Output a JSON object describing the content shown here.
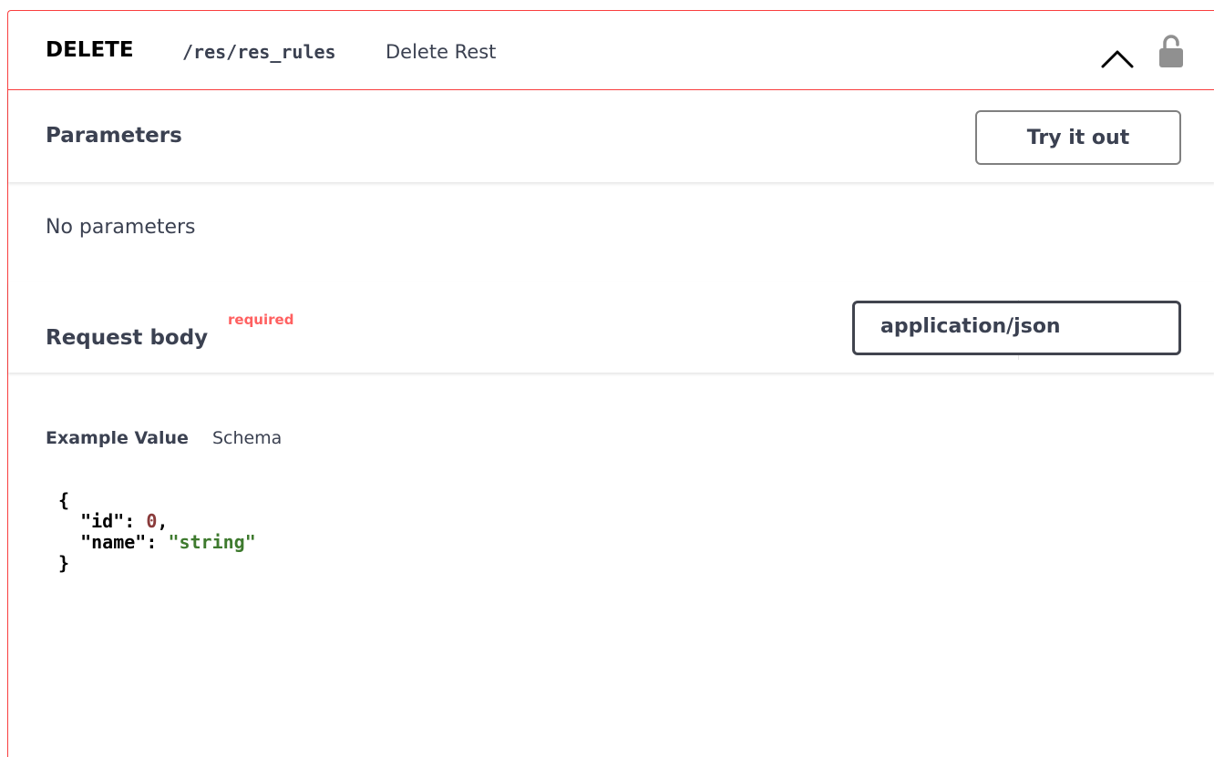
{
  "operation": {
    "method": "DELETE",
    "path": "/res/res_rules",
    "description": "Delete Rest",
    "accent_color": "#f93e3e"
  },
  "icons": {
    "collapse": "chevron-up-icon",
    "auth": "lock-icon"
  },
  "parameters": {
    "title": "Parameters",
    "try_button_label": "Try it out",
    "empty_text": "No parameters"
  },
  "request_body": {
    "title": "Request body",
    "required_label": "required",
    "content_type": "application/json",
    "tabs": {
      "example_label": "Example Value",
      "schema_label": "Schema"
    },
    "example": {
      "open_brace": "{",
      "id_key": "\"id\"",
      "id_value": "0",
      "name_key": "\"name\"",
      "name_value": "\"string\"",
      "close_brace": "}"
    }
  }
}
